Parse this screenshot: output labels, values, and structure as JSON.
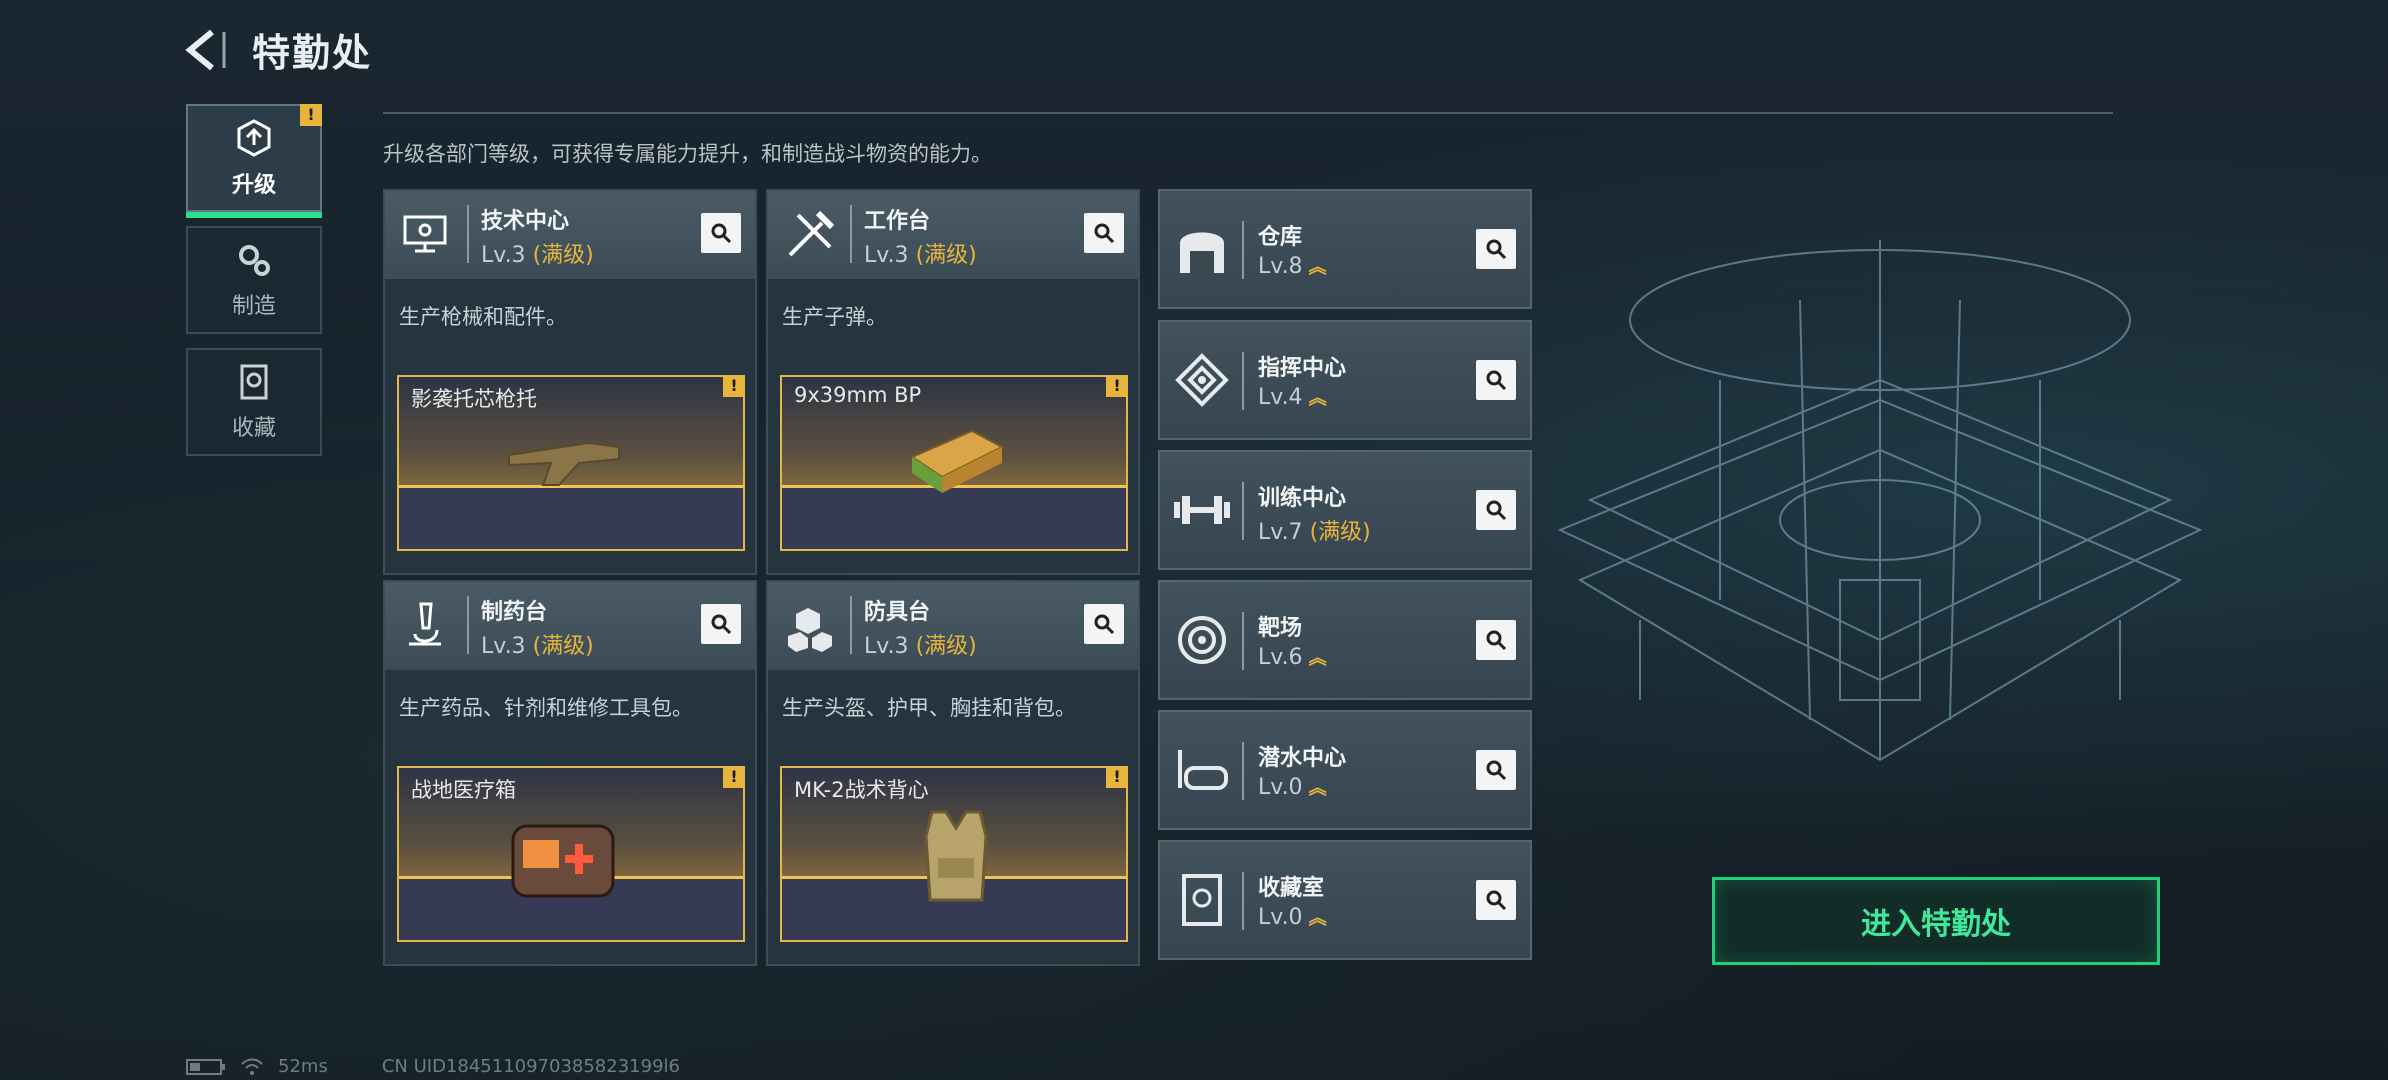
{
  "header": {
    "title": "特勤处"
  },
  "side_tabs": [
    {
      "label": "升级",
      "icon": "upgrade-icon",
      "active": true,
      "warning": "!"
    },
    {
      "label": "制造",
      "icon": "gears-icon",
      "active": false
    },
    {
      "label": "收藏",
      "icon": "collection-icon",
      "active": false
    }
  ],
  "description": "升级各部门等级，可获得专属能力提升，和制造战斗物资的能力。",
  "big_cards": [
    {
      "name": "技术中心",
      "level": "Lv.3",
      "max": "(满级)",
      "desc": "生产枪械和配件。",
      "icon": "monitor-icon",
      "product": {
        "name": "影袭托芯枪托",
        "warning": "!"
      }
    },
    {
      "name": "工作台",
      "level": "Lv.3",
      "max": "(满级)",
      "desc": "生产子弹。",
      "icon": "tools-icon",
      "product": {
        "name": "9x39mm BP",
        "warning": "!"
      }
    },
    {
      "name": "制药台",
      "level": "Lv.3",
      "max": "(满级)",
      "desc": "生产药品、针剂和维修工具包。",
      "icon": "microscope-icon",
      "product": {
        "name": "战地医疗箱",
        "warning": "!"
      }
    },
    {
      "name": "防具台",
      "level": "Lv.3",
      "max": "(满级)",
      "desc": "生产头盔、护甲、胸挂和背包。",
      "icon": "armor-icon",
      "product": {
        "name": "MK-2战术背心",
        "warning": "!"
      }
    }
  ],
  "small_cards": [
    {
      "name": "仓库",
      "level": "Lv.8",
      "max": "",
      "icon": "warehouse-icon",
      "upgrade": "︽"
    },
    {
      "name": "指挥中心",
      "level": "Lv.4",
      "max": "",
      "icon": "command-icon",
      "upgrade": "︽"
    },
    {
      "name": "训练中心",
      "level": "Lv.7",
      "max": "(满级)",
      "icon": "dumbbell-icon",
      "upgrade": ""
    },
    {
      "name": "靶场",
      "level": "Lv.6",
      "max": "",
      "icon": "target-icon",
      "upgrade": "︽"
    },
    {
      "name": "潜水中心",
      "level": "Lv.0",
      "max": "",
      "icon": "diving-mask-icon",
      "upgrade": "︽"
    },
    {
      "name": "收藏室",
      "level": "Lv.0",
      "max": "",
      "icon": "vault-icon",
      "upgrade": "︽"
    }
  ],
  "enter_button": "进入特勤处",
  "status_bar": {
    "ping": "52ms",
    "uid": "CN UID1845110970385823199l6"
  },
  "colors": {
    "accent_green": "#22d07b",
    "warning_yellow": "#e8b53a",
    "max_level": "#e8b53a"
  }
}
